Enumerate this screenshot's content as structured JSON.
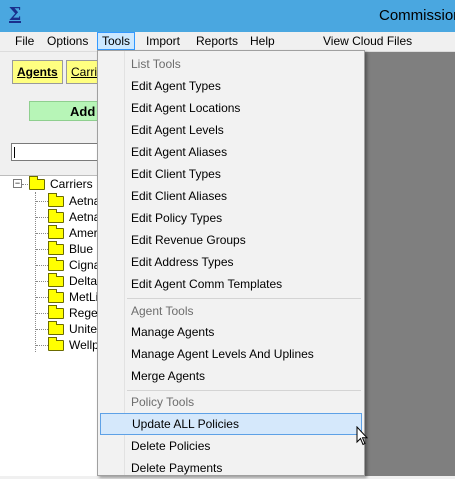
{
  "window": {
    "title": "Commission",
    "app_icon": "sigma-icon"
  },
  "menubar": {
    "items": [
      {
        "label": "File"
      },
      {
        "label": "Options"
      },
      {
        "label": "Tools",
        "active": true
      },
      {
        "label": "Import"
      },
      {
        "label": "Reports"
      },
      {
        "label": "Help"
      },
      {
        "label": "View Cloud Files"
      }
    ]
  },
  "leftpane": {
    "tabs": [
      {
        "label": "Agents"
      },
      {
        "label": "Carri"
      }
    ],
    "add_label": "Add",
    "search": {
      "value": "",
      "placeholder": ""
    },
    "tree": {
      "root": {
        "label": "Carriers",
        "expander": "−"
      },
      "children": [
        {
          "label": "Aetna"
        },
        {
          "label": "Aetna"
        },
        {
          "label": "Ameri"
        },
        {
          "label": "Blue C"
        },
        {
          "label": "Cigna"
        },
        {
          "label": "Delta"
        },
        {
          "label": "MetLi"
        },
        {
          "label": "Rege"
        },
        {
          "label": "Unite"
        },
        {
          "label": "Wellp"
        }
      ]
    }
  },
  "tools_menu": {
    "sections": [
      {
        "header": "List Tools",
        "items": [
          "Edit Agent Types",
          "Edit Agent Locations",
          "Edit Agent Levels",
          "Edit Agent Aliases",
          "Edit Client Types",
          "Edit Client Aliases",
          "Edit Policy Types",
          "Edit Revenue Groups",
          "Edit Address Types",
          "Edit Agent Comm Templates"
        ]
      },
      {
        "header": "Agent Tools",
        "items": [
          "Manage Agents",
          "Manage Agent Levels And Uplines",
          "Merge Agents"
        ]
      },
      {
        "header": "Policy Tools",
        "items": [
          "Update ALL Policies",
          "Delete Policies",
          "Delete Payments"
        ],
        "hovered_item": "Update ALL Policies"
      }
    ]
  },
  "colors": {
    "titlebar": "#4aa7e0",
    "tab_yellow": "#ffff80",
    "add_green": "#b7f5b7",
    "folder_yellow": "#ffff00",
    "hover_blue": "#d5e8fb",
    "dark_area": "#7f7f7f"
  }
}
